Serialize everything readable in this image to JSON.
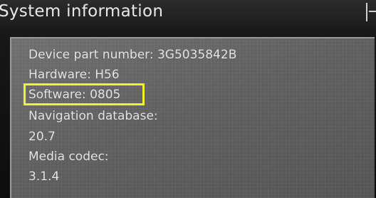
{
  "header": {
    "title": "System information"
  },
  "info": {
    "device_part_number": "Device part number: 3G5035842B",
    "hardware": "Hardware: H56",
    "software": "Software: 0805",
    "navigation_database_label": "Navigation database:",
    "navigation_database_value": "20.7",
    "media_codec_label": "Media codec:",
    "media_codec_value": "3.1.4"
  },
  "colors": {
    "highlight": "#f2f22a",
    "panel": "#666666",
    "text": "#e6e6e6"
  },
  "icons": {
    "close": "close-icon"
  }
}
